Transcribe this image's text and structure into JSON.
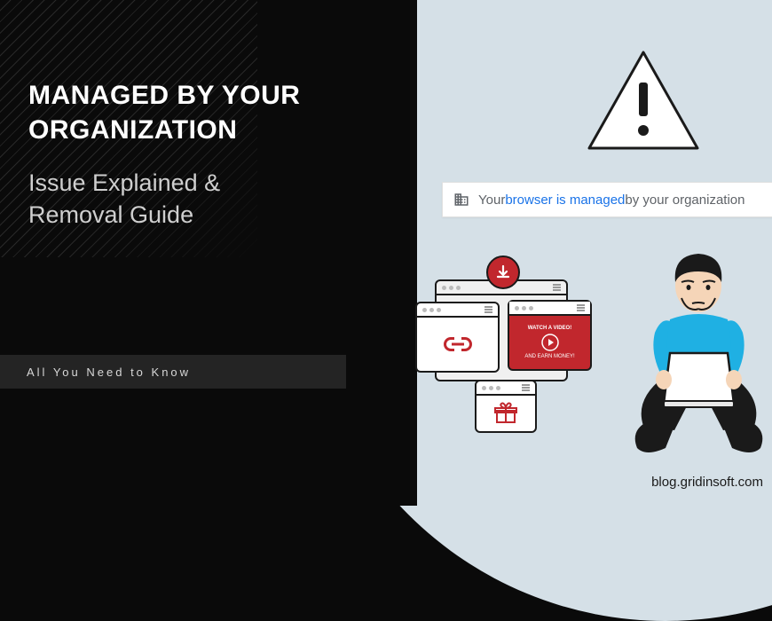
{
  "heading": {
    "main_line1": "MANAGED BY YOUR",
    "main_line2": "ORGANIZATION",
    "sub_line1": "Issue Explained &",
    "sub_line2": "Removal Guide"
  },
  "tag": "All You Need to Know",
  "notice": {
    "prefix": "Your ",
    "link": "browser is managed",
    "suffix": " by your organization"
  },
  "video_card": {
    "title": "WATCH A VIDEO!",
    "subtitle": "AND EARN MONEY!"
  },
  "footer_url": "blog.gridinsoft.com"
}
